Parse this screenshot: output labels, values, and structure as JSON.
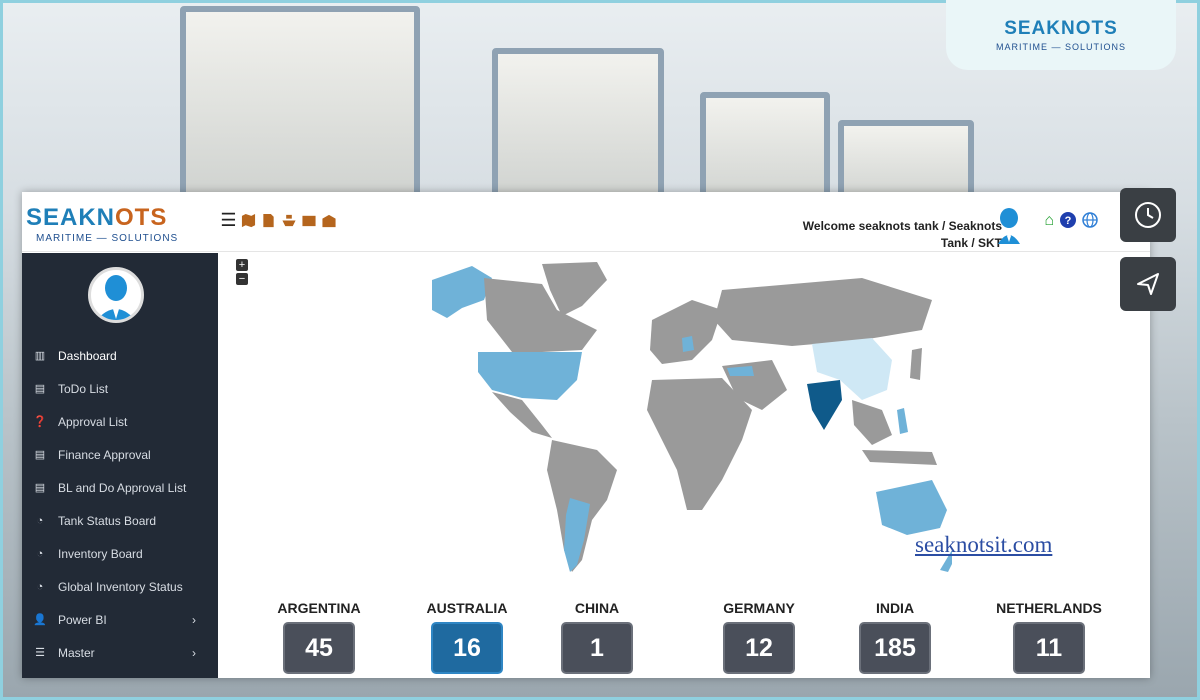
{
  "brand_badge": {
    "name": "SEAKNOTS",
    "tagline": "MARITIME — SOLUTIONS"
  },
  "header": {
    "logo_name_a": "SEAKN",
    "logo_name_b": "OTS",
    "logo_tagline": "MARITIME — SOLUTIONS",
    "welcome_line1": "Welcome seaknots tank / Seaknots",
    "welcome_line2": "Tank / SKT",
    "toolbar_icons": [
      "menu-icon",
      "map-icon",
      "document-icon",
      "ship-icon",
      "box-icon",
      "warehouse-icon"
    ],
    "right_icons": [
      "home-icon",
      "help-icon",
      "globe-icon"
    ]
  },
  "side_buttons": [
    "clock-icon",
    "send-icon"
  ],
  "sidebar": {
    "items": [
      {
        "label": "Dashboard",
        "icon": "bar-chart-icon",
        "active": true
      },
      {
        "label": "ToDo List",
        "icon": "clipboard-icon"
      },
      {
        "label": "Approval List",
        "icon": "question-circle-icon"
      },
      {
        "label": "Finance Approval",
        "icon": "document-icon"
      },
      {
        "label": "BL and Do Approval List",
        "icon": "document-icon"
      },
      {
        "label": "Tank Status Board",
        "icon": "pie-chart-icon"
      },
      {
        "label": "Inventory Board",
        "icon": "pie-chart-icon"
      },
      {
        "label": "Global Inventory Status",
        "icon": "pie-chart-icon"
      },
      {
        "label": "Power BI",
        "icon": "user-icon",
        "chevron": "›"
      },
      {
        "label": "Master",
        "icon": "database-icon",
        "chevron": "›"
      }
    ]
  },
  "map": {
    "zoom_in": "+",
    "zoom_out": "−",
    "highlight_colors": {
      "base": "#9a9a9a",
      "low": "#cfe8f5",
      "mid": "#6fb2d8",
      "high": "#3d8fc2",
      "top": "#0f5a8a"
    }
  },
  "watermark": "seaknotsit.com",
  "countries": [
    {
      "name": "ARGENTINA",
      "value": "45"
    },
    {
      "name": "AUSTRALIA",
      "value": "16"
    },
    {
      "name": "CHINA",
      "value": "1"
    },
    {
      "name": "GERMANY",
      "value": "12"
    },
    {
      "name": "INDIA",
      "value": "185"
    },
    {
      "name": "NETHERLANDS",
      "value": "11"
    }
  ]
}
